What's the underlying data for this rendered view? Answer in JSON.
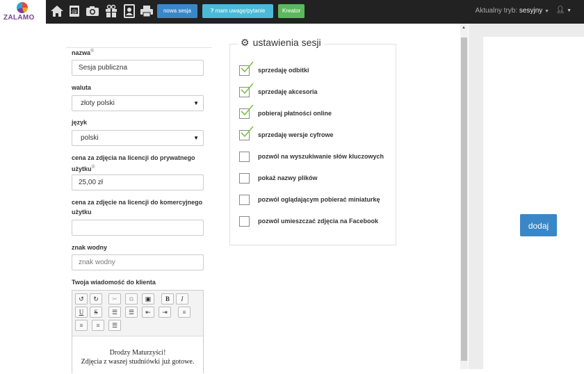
{
  "topbar": {
    "logo_text": "ZALAMO",
    "icons": [
      "home-icon",
      "book-icon",
      "camera-icon",
      "gift-icon",
      "portrait-icon",
      "printer-icon"
    ],
    "new_session_label": "nowa sesja",
    "feedback_label": "mam uwagę/pytanie",
    "wizard_label": "Kreator",
    "mode_label": "Aktualny tryb:",
    "mode_value": "sesyjny",
    "colors": {
      "bar": "#222222",
      "blue": "#3a87c8",
      "cyan": "#4bbad7",
      "green": "#5cb85c"
    }
  },
  "form": {
    "name_label": "nazwa",
    "required_mark": "®",
    "name_value": "Sesja publiczna",
    "currency_label": "waluta",
    "currency_value": "złoty polski",
    "language_label": "język",
    "language_value": "polski",
    "price_private_label": "cena za zdjęcia na licencji do prywatnego użytku",
    "price_private_value": "25,00 zł",
    "price_commercial_label": "cena za zdjęcie na licencji do komercyjnego użytku",
    "price_commercial_value": "",
    "watermark_label": "znak wodny",
    "watermark_placeholder": "znak wodny",
    "message_label": "Twoja wiadomość do klienta",
    "editor_tools": [
      "undo",
      "redo",
      "cut",
      "copy",
      "paste",
      "B",
      "I",
      "U",
      "S",
      "ordered-list",
      "bullet-list",
      "outdent",
      "indent",
      "align-left",
      "align-right",
      "align-center",
      "justify"
    ],
    "message_lines": [
      "Drodzy Maturzyści!",
      "Zdjęcia z waszej studniówki już gotowe."
    ]
  },
  "settings": {
    "title": "ustawienia sesji",
    "options": [
      {
        "label": "sprzedaję odbitki",
        "checked": true
      },
      {
        "label": "sprzedaję akcesoria",
        "checked": true
      },
      {
        "label": "pobieraj płatności online",
        "checked": true
      },
      {
        "label": "sprzedaję wersje cyfrowe",
        "checked": true
      },
      {
        "label": "pozwól na wyszukiwanie słów kluczowych",
        "checked": false
      },
      {
        "label": "pokaż nazwy plików",
        "checked": false
      },
      {
        "label": "pozwól oglądającym pobierać miniaturkę",
        "checked": false
      },
      {
        "label": "pozwól umieszczać zdjęcia na Facebook",
        "checked": false
      }
    ],
    "check_color": "#7cc242"
  },
  "sidepanel": {
    "add_label": "dodaj"
  }
}
